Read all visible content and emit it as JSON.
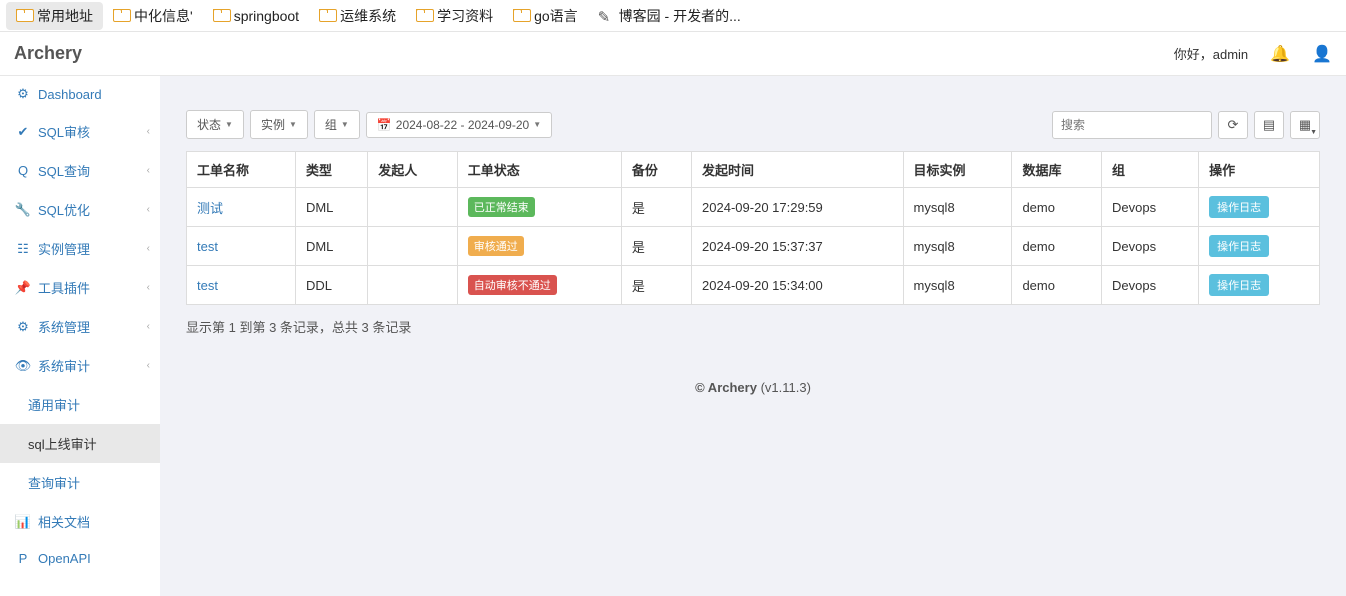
{
  "bookmarks": [
    {
      "label": "常用地址",
      "icon": "folder",
      "active": true
    },
    {
      "label": "中化信息'",
      "icon": "folder"
    },
    {
      "label": "springboot",
      "icon": "folder"
    },
    {
      "label": "运维系统",
      "icon": "folder"
    },
    {
      "label": "学习资料",
      "icon": "folder"
    },
    {
      "label": "go语言",
      "icon": "folder"
    },
    {
      "label": "博客园 - 开发者的...",
      "icon": "edit"
    }
  ],
  "brand": "Archery",
  "greet": "你好，admin",
  "sidebar": {
    "items": [
      {
        "label": "Dashboard",
        "icon": "dashboard-icon",
        "glyph": "⚙",
        "expandable": false
      },
      {
        "label": "SQL审核",
        "icon": "check-icon",
        "glyph": "✔",
        "expandable": true
      },
      {
        "label": "SQL查询",
        "icon": "search-icon",
        "glyph": "Q",
        "expandable": true
      },
      {
        "label": "SQL优化",
        "icon": "wrench-icon",
        "glyph": "🔧",
        "expandable": true
      },
      {
        "label": "实例管理",
        "icon": "list-icon",
        "glyph": "☷",
        "expandable": true
      },
      {
        "label": "工具插件",
        "icon": "pin-icon",
        "glyph": "📌",
        "expandable": true
      },
      {
        "label": "系统管理",
        "icon": "cogs-icon",
        "glyph": "⚙",
        "expandable": true
      },
      {
        "label": "系统审计",
        "icon": "eye-icon",
        "glyph": "👁",
        "expandable": true,
        "expanded": true,
        "children": [
          {
            "label": "通用审计",
            "active": false
          },
          {
            "label": "sql上线审计",
            "active": true
          },
          {
            "label": "查询审计",
            "active": false
          }
        ]
      },
      {
        "label": "相关文档",
        "icon": "bars-icon",
        "glyph": "📊",
        "expandable": false
      },
      {
        "label": "OpenAPI",
        "icon": "p-icon",
        "glyph": "P",
        "expandable": false
      }
    ]
  },
  "filters": {
    "status": "状态",
    "instance": "实例",
    "group": "组",
    "daterange": "2024-08-22 - 2024-09-20"
  },
  "search_placeholder": "搜索",
  "table": {
    "headers": [
      "工单名称",
      "类型",
      "发起人",
      "工单状态",
      "备份",
      "发起时间",
      "目标实例",
      "数据库",
      "组",
      "操作"
    ],
    "rows": [
      {
        "name": "测试",
        "type": "DML",
        "user": "",
        "status": "已正常结束",
        "status_cls": "b-green",
        "backup": "是",
        "time": "2024-09-20 17:29:59",
        "instance": "mysql8",
        "db": "demo",
        "group": "Devops",
        "op": "操作日志"
      },
      {
        "name": "test",
        "type": "DML",
        "user": "",
        "status": "审核通过",
        "status_cls": "b-orange",
        "backup": "是",
        "time": "2024-09-20 15:37:37",
        "instance": "mysql8",
        "db": "demo",
        "group": "Devops",
        "op": "操作日志"
      },
      {
        "name": "test",
        "type": "DDL",
        "user": "",
        "status": "自动审核不通过",
        "status_cls": "b-red",
        "backup": "是",
        "time": "2024-09-20 15:34:00",
        "instance": "mysql8",
        "db": "demo",
        "group": "Devops",
        "op": "操作日志"
      }
    ]
  },
  "summary": "显示第 1 到第 3 条记录，总共 3 条记录",
  "footer": {
    "strong": "© Archery",
    "rest": " (v1.11.3)"
  }
}
